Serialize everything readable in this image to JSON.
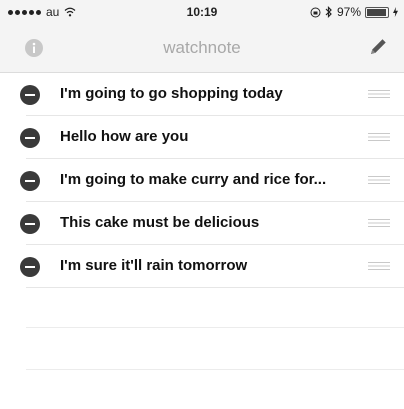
{
  "status_bar": {
    "carrier": "au",
    "time": "10:19",
    "battery": "97%",
    "battery_level": 0.97
  },
  "nav": {
    "title": "watchnote",
    "left_icon": "info-icon",
    "right_icon": "pencil-icon"
  },
  "notes": [
    {
      "text": "I'm going to go shopping today"
    },
    {
      "text": "Hello how are you"
    },
    {
      "text": "I'm going to make curry and rice for..."
    },
    {
      "text": "This cake must be delicious"
    },
    {
      "text": "I'm sure it'll rain tomorrow"
    }
  ],
  "colors": {
    "delete_button": "#3a3a3a",
    "bar_background": "#f4f4f4",
    "title": "#a8a8a8"
  }
}
